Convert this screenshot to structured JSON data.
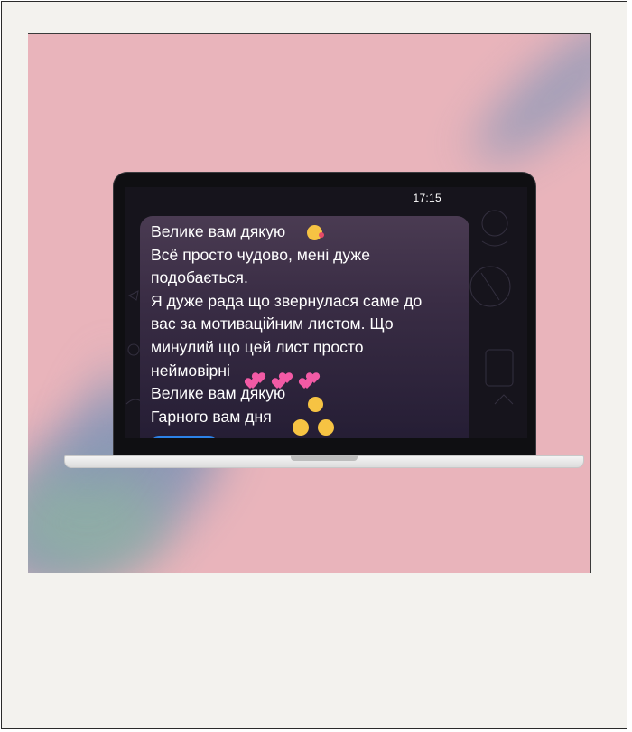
{
  "phone_status": {
    "time": "17:15"
  },
  "message": {
    "text": "Велике вам дякую\nВсё просто чудово, мені дуже\nподобається.\nЯ дуже рада що звернулася саме до\nвас за мотиваційним листом. Що\nминулий що цей лист просто\nнеймовірні\nВелике вам дякую\nГарного вам дня",
    "emoji_icons": [
      "face-blowing-kiss-icon",
      "two-hearts-icon",
      "smiling-face-icon",
      "smiling-face-with-smiling-eyes-icon"
    ]
  },
  "colors": {
    "photo_background": "#e9b4bb",
    "frame": "#f3f2ee",
    "bubble_top": "#4a3b52",
    "bubble_bottom": "#231c33",
    "accent_blue": "#2c82e8",
    "heart_pink": "#f25aa5"
  }
}
